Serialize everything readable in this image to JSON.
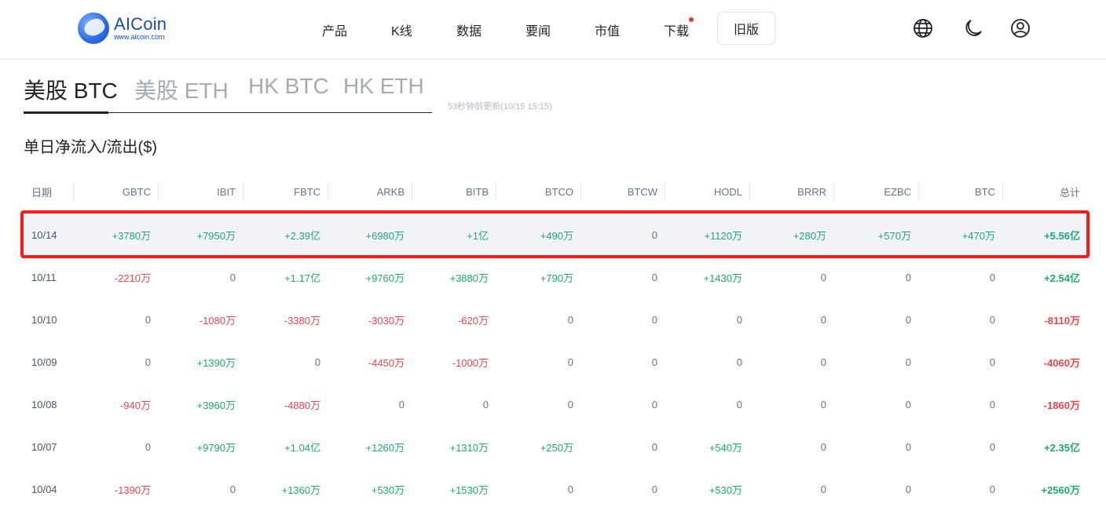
{
  "header": {
    "logo": {
      "name": "AICoin",
      "url": "www.aicoin.com"
    },
    "nav": [
      {
        "label": "产品",
        "has_dot": false
      },
      {
        "label": "K线",
        "has_dot": false
      },
      {
        "label": "数据",
        "has_dot": false
      },
      {
        "label": "要闻",
        "has_dot": false
      },
      {
        "label": "市值",
        "has_dot": false
      },
      {
        "label": "下载",
        "has_dot": true
      }
    ],
    "old_version": "旧版",
    "icons": [
      "globe-icon",
      "moon-icon",
      "user-icon"
    ],
    "dot_color": "#e8363a"
  },
  "tabs": [
    {
      "label": "美股 BTC",
      "active": true
    },
    {
      "label": "美股 ETH",
      "active": false
    },
    {
      "label": "HK BTC",
      "active": false
    },
    {
      "label": "HK ETH",
      "active": false
    }
  ],
  "update_time": "53秒钟前更新(10/15 15:15)",
  "section_title": "单日净流入/流出($)",
  "colors": {
    "positive": "#1fa872",
    "negative": "#e5484d",
    "highlight_border": "#ff1a1a"
  },
  "table": {
    "columns": [
      "日期",
      "GBTC",
      "IBIT",
      "FBTC",
      "ARKB",
      "BITB",
      "BTCO",
      "BTCW",
      "HODL",
      "BRRR",
      "EZBC",
      "BTC",
      "总计"
    ],
    "highlighted_row": 0,
    "rows": [
      [
        "10/14",
        "+3780万",
        "+7950万",
        "+2.39亿",
        "+6980万",
        "+1亿",
        "+490万",
        "0",
        "+1120万",
        "+280万",
        "+570万",
        "+470万",
        "+5.56亿"
      ],
      [
        "10/11",
        "-2210万",
        "0",
        "+1.17亿",
        "+9760万",
        "+3880万",
        "+790万",
        "0",
        "+1430万",
        "0",
        "0",
        "0",
        "+2.54亿"
      ],
      [
        "10/10",
        "0",
        "-1080万",
        "-3380万",
        "-3030万",
        "-620万",
        "0",
        "0",
        "0",
        "0",
        "0",
        "0",
        "-8110万"
      ],
      [
        "10/09",
        "0",
        "+1390万",
        "0",
        "-4450万",
        "-1000万",
        "0",
        "0",
        "0",
        "0",
        "0",
        "0",
        "-4060万"
      ],
      [
        "10/08",
        "-940万",
        "+3960万",
        "-4880万",
        "0",
        "0",
        "0",
        "0",
        "0",
        "0",
        "0",
        "0",
        "-1860万"
      ],
      [
        "10/07",
        "0",
        "+9790万",
        "+1.04亿",
        "+1260万",
        "+1310万",
        "+250万",
        "0",
        "+540万",
        "0",
        "0",
        "0",
        "+2.35亿"
      ],
      [
        "10/04",
        "-1390万",
        "0",
        "+1360万",
        "+530万",
        "+1530万",
        "0",
        "0",
        "+530万",
        "0",
        "0",
        "0",
        "+2560万"
      ]
    ]
  }
}
